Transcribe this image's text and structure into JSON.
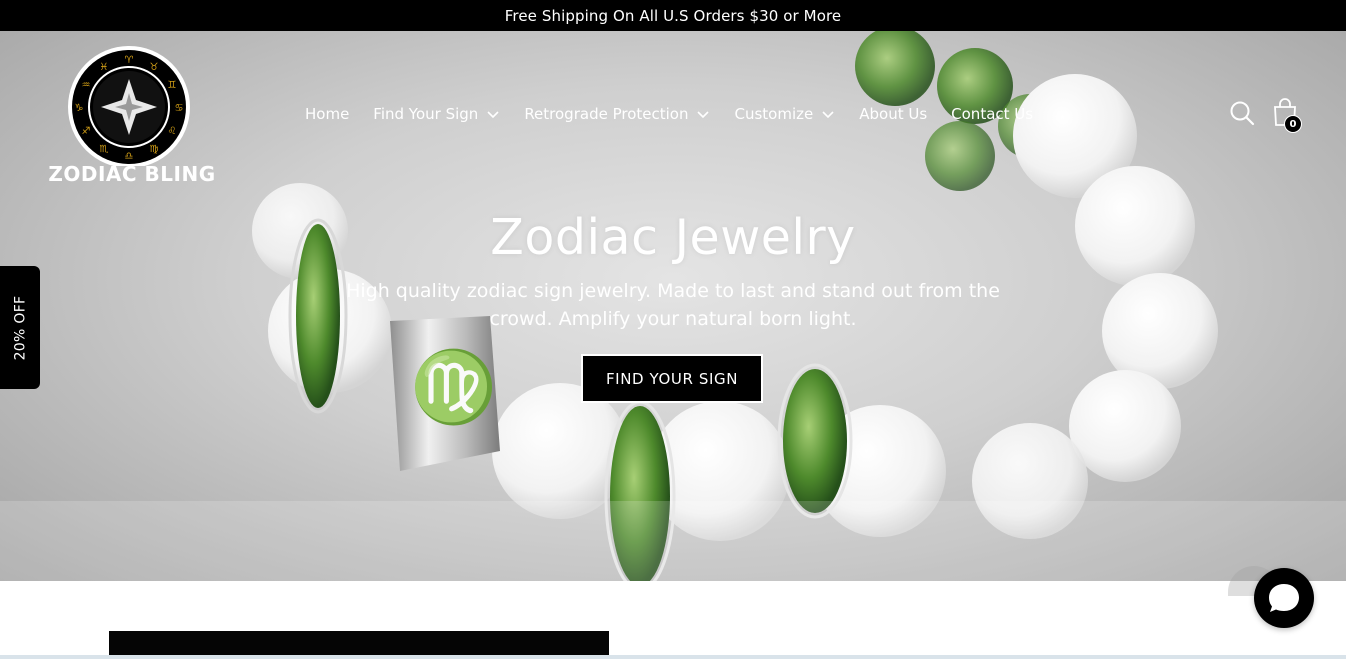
{
  "announcement": {
    "text": "Free Shipping On All U.S Orders $30 or More"
  },
  "brand": {
    "name": "ZODIAC BLING"
  },
  "nav": {
    "items": [
      {
        "label": "Home",
        "has_dropdown": false
      },
      {
        "label": "Find Your Sign",
        "has_dropdown": true
      },
      {
        "label": "Retrograde Protection",
        "has_dropdown": true
      },
      {
        "label": "Customize",
        "has_dropdown": true
      },
      {
        "label": "About Us",
        "has_dropdown": false
      },
      {
        "label": "Contact Us",
        "has_dropdown": false
      }
    ]
  },
  "header_icons": {
    "search": "search-icon",
    "cart": "shopping-bag-icon",
    "cart_count": "0"
  },
  "hero": {
    "title": "Zodiac Jewelry",
    "subtitle": "High quality zodiac sign jewelry. Made to last and stand out from the crowd. Amplify your natural born light.",
    "cta_label": "FIND YOUR SIGN"
  },
  "promo_tab": {
    "label": "20% OFF"
  },
  "chat": {
    "icon": "chat-bubble-icon"
  },
  "colors": {
    "announcement_bg": "#000000",
    "cta_bg": "#000000",
    "text_on_dark": "#ffffff"
  }
}
